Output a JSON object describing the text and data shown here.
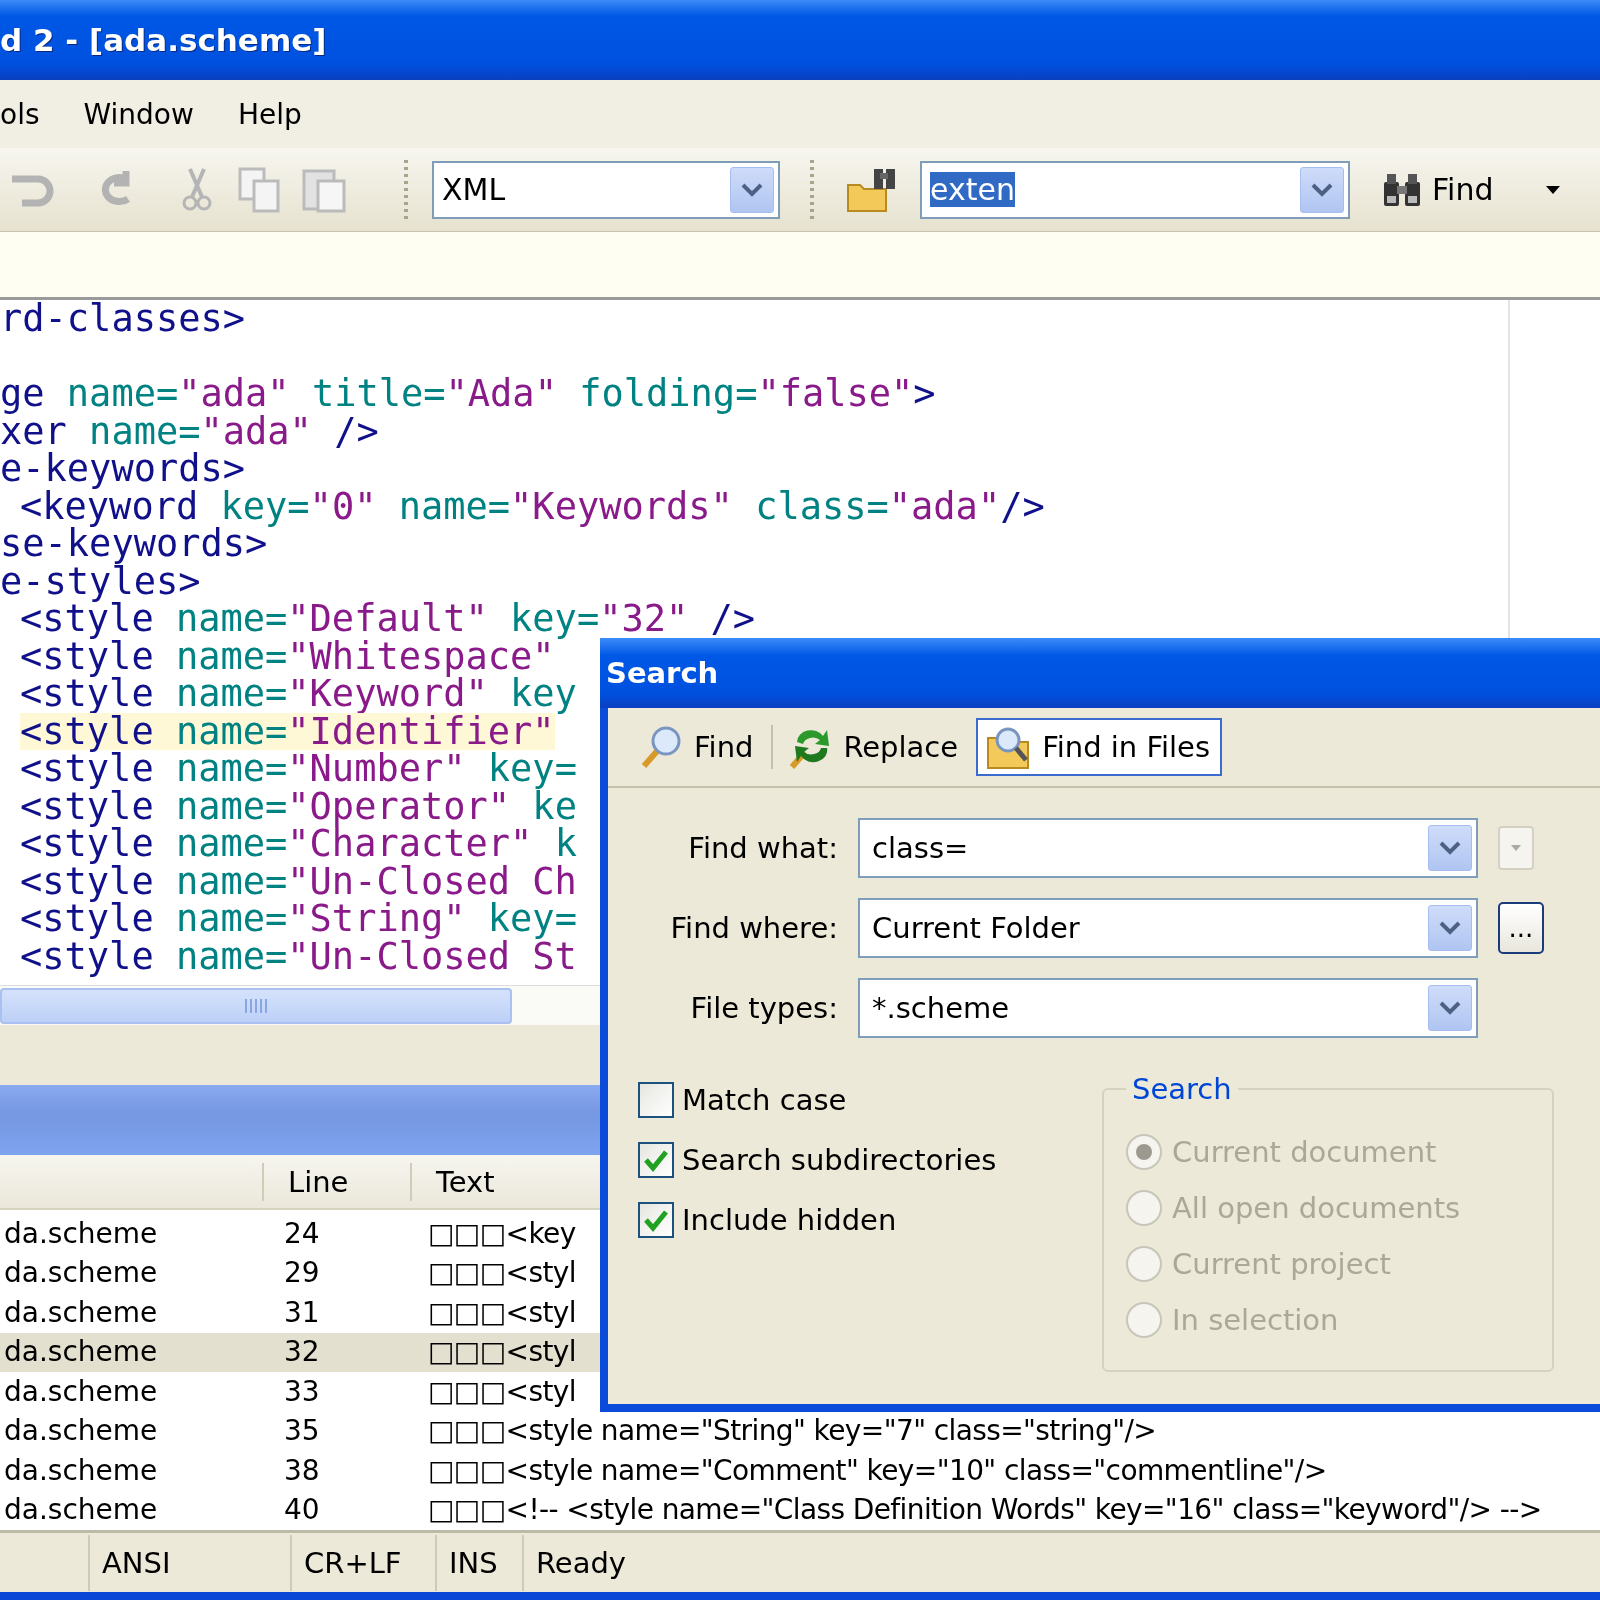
{
  "window": {
    "title": "d 2 - [ada.scheme]"
  },
  "menu": [
    {
      "label": "ols"
    },
    {
      "label": "Window"
    },
    {
      "label": "Help"
    }
  ],
  "toolbar": {
    "syntax": "XML",
    "find_text": "exten",
    "find_text_selected": true,
    "find_button": "Find"
  },
  "editor": {
    "lines": [
      {
        "segments": [
          {
            "kind": "tag",
            "text": "rd-classes>"
          }
        ]
      },
      {
        "blank": true
      },
      {
        "segments": [
          {
            "kind": "tag",
            "text": "ge"
          },
          {
            "kind": "attr",
            "text": " name="
          },
          {
            "kind": "value",
            "text": "\"ada\""
          },
          {
            "kind": "attr",
            "text": " title="
          },
          {
            "kind": "value",
            "text": "\"Ada\""
          },
          {
            "kind": "attr",
            "text": " folding="
          },
          {
            "kind": "value",
            "text": "\"false\""
          },
          {
            "kind": "tag",
            "text": ">"
          }
        ]
      },
      {
        "segments": [
          {
            "kind": "tag",
            "text": "xer"
          },
          {
            "kind": "attr",
            "text": " name="
          },
          {
            "kind": "value",
            "text": "\"ada\""
          },
          {
            "kind": "tag",
            "text": " />"
          }
        ]
      },
      {
        "segments": [
          {
            "kind": "tag",
            "text": "e-keywords>"
          }
        ]
      },
      {
        "indent": true,
        "segments": [
          {
            "kind": "tag",
            "text": "<keyword"
          },
          {
            "kind": "attr",
            "text": " key="
          },
          {
            "kind": "value",
            "text": "\"0\""
          },
          {
            "kind": "attr",
            "text": " name="
          },
          {
            "kind": "value",
            "text": "\"Keywords\""
          },
          {
            "kind": "attr",
            "text": " class="
          },
          {
            "kind": "value",
            "text": "\"ada\""
          },
          {
            "kind": "tag",
            "text": "/>"
          }
        ]
      },
      {
        "segments": [
          {
            "kind": "tag",
            "text": "se-keywords>"
          }
        ]
      },
      {
        "segments": [
          {
            "kind": "tag",
            "text": "e-styles>"
          }
        ]
      },
      {
        "indent": true,
        "segments": [
          {
            "kind": "tag",
            "text": "<style"
          },
          {
            "kind": "attr",
            "text": " name="
          },
          {
            "kind": "value",
            "text": "\"Default\""
          },
          {
            "kind": "attr",
            "text": " key="
          },
          {
            "kind": "value",
            "text": "\"32\""
          },
          {
            "kind": "tag",
            "text": " />"
          }
        ]
      },
      {
        "indent": true,
        "segments": [
          {
            "kind": "tag",
            "text": "<style"
          },
          {
            "kind": "attr",
            "text": " name="
          },
          {
            "kind": "value",
            "text": "\"Whitespace\""
          }
        ]
      },
      {
        "indent": true,
        "segments": [
          {
            "kind": "tag",
            "text": "<style"
          },
          {
            "kind": "attr",
            "text": " name="
          },
          {
            "kind": "value",
            "text": "\"Keyword\""
          },
          {
            "kind": "attr",
            "text": " key"
          }
        ]
      },
      {
        "indent": true,
        "highlighted": true,
        "segments": [
          {
            "kind": "tag",
            "text": "<style"
          },
          {
            "kind": "attr",
            "text": " name="
          },
          {
            "kind": "value",
            "text": "\"Identifier\""
          }
        ]
      },
      {
        "indent": true,
        "segments": [
          {
            "kind": "tag",
            "text": "<style"
          },
          {
            "kind": "attr",
            "text": " name="
          },
          {
            "kind": "value",
            "text": "\"Number\""
          },
          {
            "kind": "attr",
            "text": " key="
          }
        ]
      },
      {
        "indent": true,
        "segments": [
          {
            "kind": "tag",
            "text": "<style"
          },
          {
            "kind": "attr",
            "text": " name="
          },
          {
            "kind": "value",
            "text": "\"Operator\""
          },
          {
            "kind": "attr",
            "text": " ke"
          }
        ]
      },
      {
        "indent": true,
        "segments": [
          {
            "kind": "tag",
            "text": "<style"
          },
          {
            "kind": "attr",
            "text": " name="
          },
          {
            "kind": "value",
            "text": "\"Character\""
          },
          {
            "kind": "attr",
            "text": " k"
          }
        ]
      },
      {
        "indent": true,
        "segments": [
          {
            "kind": "tag",
            "text": "<style"
          },
          {
            "kind": "attr",
            "text": " name="
          },
          {
            "kind": "value",
            "text": "\"Un-Closed Ch"
          }
        ]
      },
      {
        "indent": true,
        "segments": [
          {
            "kind": "tag",
            "text": "<style"
          },
          {
            "kind": "attr",
            "text": " name="
          },
          {
            "kind": "value",
            "text": "\"String\""
          },
          {
            "kind": "attr",
            "text": " key="
          }
        ]
      },
      {
        "indent": true,
        "segments": [
          {
            "kind": "tag",
            "text": "<style"
          },
          {
            "kind": "attr",
            "text": " name="
          },
          {
            "kind": "value",
            "text": "\"Un-Closed St"
          }
        ]
      }
    ]
  },
  "results": {
    "columns": [
      "Line",
      "Text"
    ],
    "rows": [
      {
        "file": "da.scheme",
        "line": "24",
        "text": "□□□<key",
        "selected": false
      },
      {
        "file": "da.scheme",
        "line": "29",
        "text": "□□□<styl",
        "selected": false
      },
      {
        "file": "da.scheme",
        "line": "31",
        "text": "□□□<styl",
        "selected": false
      },
      {
        "file": "da.scheme",
        "line": "32",
        "text": "□□□<styl",
        "selected": true
      },
      {
        "file": "da.scheme",
        "line": "33",
        "text": "□□□<styl",
        "selected": false
      },
      {
        "file": "da.scheme",
        "line": "35",
        "text": "□□□<style name=\"String\" key=\"7\" class=\"string\"/>",
        "selected": false
      },
      {
        "file": "da.scheme",
        "line": "38",
        "text": "□□□<style name=\"Comment\" key=\"10\" class=\"commentline\"/>",
        "selected": false
      },
      {
        "file": "da.scheme",
        "line": "40",
        "text": "□□□<!-- <style name=\"Class Definition Words\" key=\"16\" class=\"keyword\"/> -->",
        "selected": false
      }
    ]
  },
  "status_bar": [
    "ANSI",
    "CR+LF",
    "INS",
    "Ready"
  ],
  "dialog": {
    "title": "Search",
    "tabs": [
      {
        "kind": "find",
        "label": "Find",
        "selected": false
      },
      {
        "kind": "replace",
        "label": "Replace",
        "selected": false
      },
      {
        "kind": "files",
        "label": "Find in Files",
        "selected": true
      }
    ],
    "fields": [
      {
        "kind": "options",
        "label": "Find what:",
        "value": "class="
      },
      {
        "kind": "browse",
        "label": "Find where:",
        "value": "Current Folder",
        "button_label": "..."
      },
      {
        "kind": "plain",
        "label": "File types:",
        "value": "*.scheme"
      }
    ],
    "checkboxes": [
      {
        "label": "Match case",
        "checked": false
      },
      {
        "label": "Search subdirectories",
        "checked": true
      },
      {
        "label": "Include hidden",
        "checked": true
      }
    ],
    "group": {
      "title": "Search",
      "disabled": true,
      "options": [
        {
          "label": "Current document",
          "selected": true
        },
        {
          "label": "All open documents",
          "selected": false
        },
        {
          "label": "Current project",
          "selected": false
        },
        {
          "label": "In selection",
          "selected": false
        }
      ]
    }
  }
}
